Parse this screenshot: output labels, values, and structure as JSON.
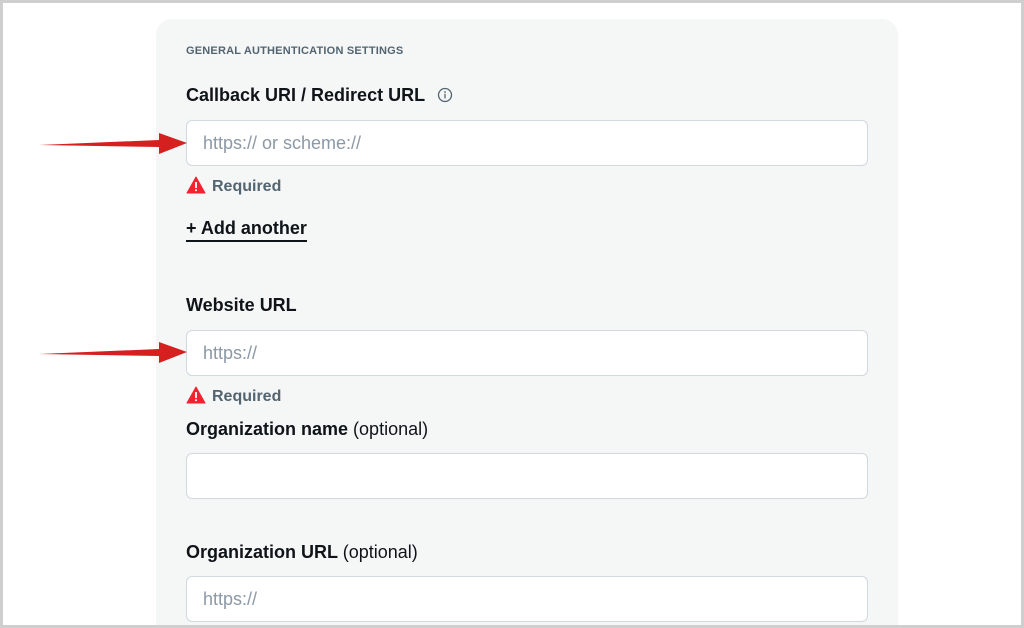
{
  "section": {
    "title": "GENERAL AUTHENTICATION SETTINGS"
  },
  "callback": {
    "label": "Callback URI / Redirect URL",
    "placeholder": "https:// or scheme://",
    "value": "",
    "error": "Required",
    "add_another": "+ Add another"
  },
  "website": {
    "label": "Website URL",
    "placeholder": "https://",
    "value": "",
    "error": "Required"
  },
  "org_name": {
    "label": "Organization name",
    "optional": "(optional)",
    "placeholder": "",
    "value": ""
  },
  "org_url": {
    "label": "Organization URL",
    "optional": "(optional)",
    "placeholder": "https://",
    "value": ""
  },
  "icons": {
    "info": "info-icon",
    "warning": "warning-triangle-icon",
    "annotation": "red-arrow-icon"
  },
  "colors": {
    "error_red": "#f4212e",
    "annotation_red": "#d61f1f",
    "panel_bg": "#f5f7f7",
    "input_border": "#cfd9de",
    "text_primary": "#0f1419",
    "text_secondary": "#536471"
  }
}
